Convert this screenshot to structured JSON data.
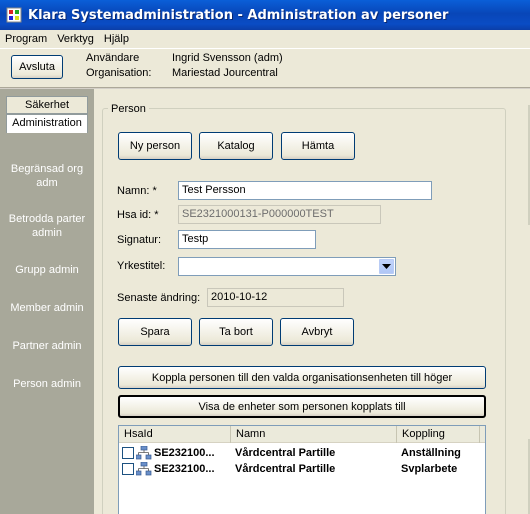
{
  "window": {
    "title": "Klara Systemadministration - Administration av personer"
  },
  "menu": {
    "items": [
      "Program",
      "Verktyg",
      "Hjälp"
    ]
  },
  "toolbar": {
    "exit_label": "Avsluta",
    "user_label": "Användare",
    "user_value": "Ingrid Svensson (adm)",
    "org_label": "Organisation:",
    "org_value": "Mariestad Jourcentral"
  },
  "nav": {
    "tabs": [
      "Säkerhet",
      "Administration"
    ],
    "items": [
      "Begränsad org adm",
      "Betrodda parter admin",
      "Grupp admin",
      "Member admin",
      "Partner admin",
      "Person admin"
    ]
  },
  "person": {
    "group_title": "Person",
    "new_label": "Ny person",
    "catalog_label": "Katalog",
    "fetch_label": "Hämta",
    "name_label": "Namn: *",
    "name_value": "Test Persson",
    "hsaid_label": "Hsa id: *",
    "hsaid_value": "SE2321000131-P000000TEST",
    "signature_label": "Signatur:",
    "signature_value": "Testp",
    "title_label": "Yrkestitel:",
    "title_value": "",
    "changed_label": "Senaste ändring:",
    "changed_value": "2010-10-12",
    "save_label": "Spara",
    "delete_label": "Ta bort",
    "cancel_label": "Avbryt",
    "link_label": "Koppla personen till den valda organisationsenheten till höger",
    "show_units_label": "Visa de enheter som personen kopplats till"
  },
  "units_table": {
    "columns": [
      "HsaId",
      "Namn",
      "Koppling"
    ],
    "rows": [
      {
        "hsaid": "SE232100...",
        "name": "Vårdcentral Partille",
        "link": "Anställning"
      },
      {
        "hsaid": "SE232100...",
        "name": "Vårdcentral Partille",
        "link": "Svplarbete"
      }
    ]
  },
  "colors": {
    "titlebar": "#0a4cc4",
    "nav_bg": "#a8a89a",
    "face": "#ece9d8"
  }
}
